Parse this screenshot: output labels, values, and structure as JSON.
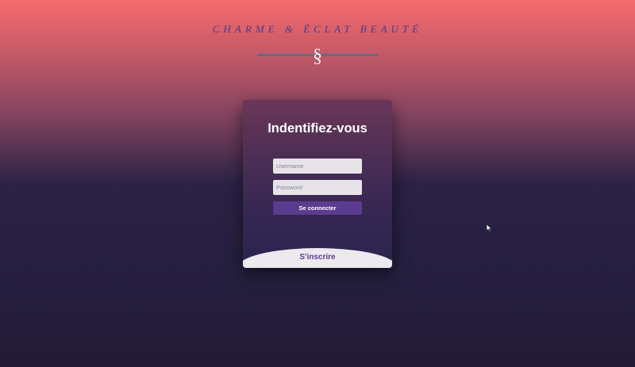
{
  "brand": {
    "name": "CHARME & ÉCLAT BEAUTÉ",
    "divider_glyph": "§"
  },
  "login": {
    "title": "Indentifiez-vous",
    "username_placeholder": "Username",
    "password_placeholder": "Password",
    "submit_label": "Se connecter",
    "signup_label": "S'inscrire"
  },
  "colors": {
    "gradient_top": "#f76b6c",
    "gradient_bottom": "#221c36",
    "brand_text": "#4a3a8c",
    "button": "#5b3c8f",
    "signup_background": "#eceaef"
  },
  "icons": {
    "cursor": "mouse-pointer-icon"
  }
}
